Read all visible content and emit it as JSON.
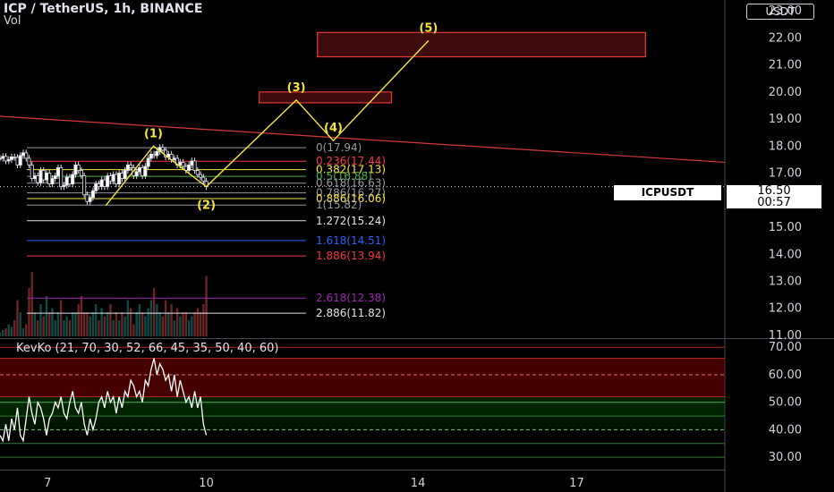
{
  "header": {
    "title": "ICP / TetherUS, 1h, BINANCE",
    "volume_label": "Vol",
    "currency_button": "USDT",
    "symbol_tag": "ICPUSDT",
    "last_price": "16.50",
    "countdown": "00:57"
  },
  "indicator": {
    "title": "KevKo (21, 70, 30, 52, 66, 45, 35, 50, 40, 60)"
  },
  "chart_data": [
    {
      "type": "line",
      "name": "price",
      "yticks": [
        "11.00",
        "12.00",
        "13.00",
        "14.00",
        "15.00",
        "16.00",
        "17.00",
        "18.00",
        "19.00",
        "20.00",
        "21.00",
        "22.00",
        "23.00"
      ],
      "ylim": [
        10.9,
        23.4
      ],
      "xticks": [
        "7",
        "10",
        "14",
        "17"
      ],
      "x_tick_values": [
        7,
        10,
        14,
        17
      ],
      "xlim": [
        6.1,
        19.8
      ],
      "grid": false,
      "fib_levels": [
        {
          "label": "0(17.94)",
          "value": 17.94,
          "color": "#9598a1"
        },
        {
          "label": "0.236(17.44)",
          "value": 17.44,
          "color": "#f23645"
        },
        {
          "label": "0.382(17.13)",
          "value": 17.13,
          "color": "#f5e53b"
        },
        {
          "label": "0.5(16.88)",
          "value": 16.88,
          "color": "#4caf50"
        },
        {
          "label": "0.618(16.63)",
          "value": 16.63,
          "color": "#9598a1"
        },
        {
          "label": "0.786(16.27)",
          "value": 16.27,
          "color": "#9598a1"
        },
        {
          "label": "0.886(16.06)",
          "value": 16.06,
          "color": "#f5e53b"
        },
        {
          "label": "1(15.82)",
          "value": 15.82,
          "color": "#9598a1"
        },
        {
          "label": "1.272(15.24)",
          "value": 15.24,
          "color": "#e0e3eb"
        },
        {
          "label": "1.618(14.51)",
          "value": 14.51,
          "color": "#2962ff"
        },
        {
          "label": "1.886(13.94)",
          "value": 13.94,
          "color": "#f23645"
        },
        {
          "label": "2.618(12.38)",
          "value": 12.38,
          "color": "#9c27b0"
        },
        {
          "label": "2.886(11.82)",
          "value": 11.82,
          "color": "#e0e3eb"
        }
      ],
      "wave_path": [
        {
          "label": "",
          "x": 8.1,
          "y": 15.8
        },
        {
          "label": "(1)",
          "x": 9.0,
          "y": 18.0
        },
        {
          "label": "(2)",
          "x": 10.0,
          "y": 16.5
        },
        {
          "label": "(3)",
          "x": 11.7,
          "y": 19.7
        },
        {
          "label": "(4)",
          "x": 12.4,
          "y": 18.2
        },
        {
          "label": "(5)",
          "x": 14.2,
          "y": 21.9
        }
      ],
      "target_zones": [
        {
          "x": [
            11.0,
            13.5
          ],
          "y": [
            19.6,
            20.0
          ]
        },
        {
          "x": [
            12.1,
            18.3
          ],
          "y": [
            21.3,
            22.2
          ]
        }
      ],
      "trendline": {
        "x": [
          6.1,
          19.8
        ],
        "y": [
          19.1,
          17.4
        ],
        "color": "#d5393a"
      },
      "close": [
        17.55,
        17.62,
        17.45,
        17.5,
        17.6,
        17.58,
        17.3,
        17.65,
        17.75,
        17.55,
        17.3,
        16.8,
        16.9,
        16.65,
        17.1,
        16.75,
        17.0,
        16.6,
        16.8,
        16.9,
        17.2,
        16.5,
        16.55,
        16.85,
        16.6,
        16.95,
        17.3,
        17.1,
        16.9,
        16.2,
        15.95,
        16.1,
        16.35,
        16.6,
        16.5,
        16.75,
        16.5,
        16.9,
        16.7,
        16.95,
        16.6,
        17.0,
        16.8,
        17.1,
        17.3,
        17.2,
        16.9,
        17.05,
        17.2,
        16.9,
        17.25,
        17.55,
        17.7,
        17.65,
        17.8,
        17.95,
        17.85,
        17.6,
        17.7,
        17.5,
        17.55,
        17.3,
        17.4,
        17.25,
        17.1,
        17.3,
        17.45,
        17.1,
        16.95,
        16.85,
        16.7,
        16.5
      ],
      "volume": [
        0.05,
        0.08,
        0.1,
        0.15,
        0.12,
        0.2,
        0.45,
        0.3,
        0.1,
        0.15,
        0.6,
        0.8,
        0.3,
        0.2,
        0.4,
        0.25,
        0.5,
        0.3,
        0.35,
        0.2,
        0.3,
        0.45,
        0.2,
        0.25,
        0.2,
        0.3,
        0.3,
        0.4,
        0.5,
        0.3,
        0.3,
        0.25,
        0.3,
        0.4,
        0.2,
        0.35,
        0.25,
        0.3,
        0.4,
        0.2,
        0.3,
        0.2,
        0.3,
        0.25,
        0.45,
        0.35,
        0.15,
        0.3,
        0.4,
        0.3,
        0.25,
        0.35,
        0.45,
        0.6,
        0.4,
        0.3,
        0.25,
        0.45,
        0.3,
        0.4,
        0.2,
        0.35,
        0.25,
        0.3,
        0.3,
        0.2,
        0.25,
        0.3,
        0.35,
        0.3,
        0.4,
        0.75
      ]
    },
    {
      "type": "line",
      "name": "KevKo",
      "yticks": [
        "30.00",
        "40.00",
        "50.00",
        "60.00",
        "70.00"
      ],
      "ylim": [
        25.5,
        73
      ],
      "levels": [
        70,
        66,
        60,
        52,
        50,
        45,
        40,
        35,
        30
      ],
      "values": [
        38,
        36,
        42,
        36,
        44,
        40,
        48,
        38,
        36,
        44,
        52,
        46,
        42,
        50,
        48,
        44,
        38,
        44,
        46,
        50,
        48,
        52,
        46,
        44,
        50,
        54,
        48,
        46,
        50,
        42,
        38,
        44,
        40,
        44,
        50,
        52,
        48,
        54,
        50,
        52,
        46,
        52,
        48,
        54,
        52,
        58,
        56,
        52,
        54,
        50,
        58,
        56,
        62,
        66,
        60,
        64,
        62,
        58,
        60,
        54,
        60,
        52,
        58,
        54,
        50,
        52,
        48,
        54,
        48,
        52,
        42,
        38
      ]
    }
  ]
}
